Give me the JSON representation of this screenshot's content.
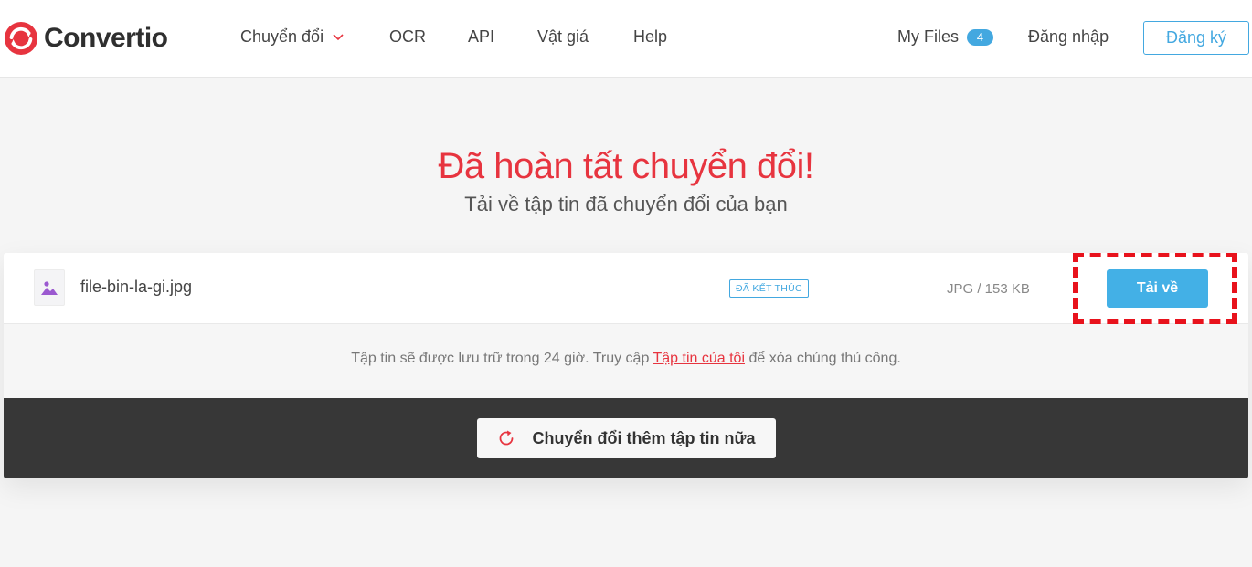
{
  "brand": {
    "name": "Convertio",
    "accent": "#e7343f",
    "blue": "#43a8e0"
  },
  "nav": {
    "items": [
      {
        "label": "Chuyển đổi",
        "has_dropdown": true
      },
      {
        "label": "OCR"
      },
      {
        "label": "API"
      },
      {
        "label": "Vật giá"
      },
      {
        "label": "Help"
      }
    ],
    "my_files_label": "My Files",
    "my_files_count": "4",
    "login_label": "Đăng nhập",
    "signup_label": "Đăng ký"
  },
  "hero": {
    "title": "Đã hoàn tất chuyển đổi!",
    "subtitle": "Tải về tập tin đã chuyển đổi của bạn"
  },
  "file": {
    "name": "file-bin-la-gi.jpg",
    "status": "ĐÃ KẾT THÚC",
    "meta": "JPG / 153 KB",
    "download_label": "Tải về",
    "icon": "image-icon"
  },
  "note": {
    "before": "Tập tin sẽ được lưu trữ trong 24 giờ. Truy cập ",
    "link": "Tập tin của tôi",
    "after": " để xóa chúng thủ công."
  },
  "convert_more": {
    "label": "Chuyển đổi thêm tập tin nữa",
    "icon": "refresh-icon"
  }
}
